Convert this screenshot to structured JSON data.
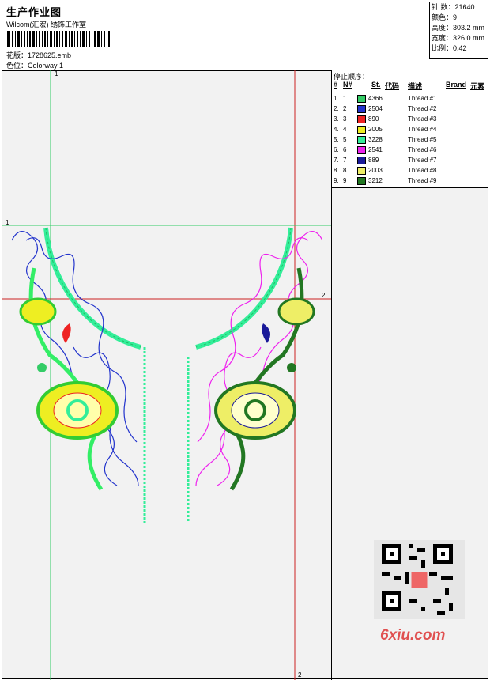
{
  "header": {
    "title": "生产作业图",
    "subtitle": "Wilcom(汇宏) 绣饰工作室",
    "pattern_label": "花版：",
    "pattern_value": "1728625.emb",
    "colorway_label": "色位：",
    "colorway_value": "Colorway 1"
  },
  "stats": [
    {
      "label": "针 数：",
      "value": "21640"
    },
    {
      "label": "颜色：",
      "value": "9"
    },
    {
      "label": "高度：",
      "value": "303.2 mm"
    },
    {
      "label": "宽度：",
      "value": "326.0 mm"
    },
    {
      "label": "比例：",
      "value": "0.42"
    }
  ],
  "thread_panel": {
    "title": "停止顺序：",
    "headers": {
      "num": "#",
      "n": "N#",
      "st": "St.",
      "code": "代码",
      "desc": "描述",
      "brand": "Brand",
      "element": "元素"
    },
    "rows": [
      {
        "idx": "1.",
        "n": "1",
        "code": "4366",
        "desc": "Thread #1",
        "color": "#33cc66"
      },
      {
        "idx": "2.",
        "n": "2",
        "code": "2504",
        "desc": "Thread #2",
        "color": "#2233cc"
      },
      {
        "idx": "3.",
        "n": "3",
        "code": "890",
        "desc": "Thread #3",
        "color": "#ee2222"
      },
      {
        "idx": "4.",
        "n": "4",
        "code": "2005",
        "desc": "Thread #4",
        "color": "#eeee22"
      },
      {
        "idx": "5.",
        "n": "5",
        "code": "3228",
        "desc": "Thread #5",
        "color": "#33ee99"
      },
      {
        "idx": "6.",
        "n": "6",
        "code": "2541",
        "desc": "Thread #6",
        "color": "#ee22ee"
      },
      {
        "idx": "7.",
        "n": "7",
        "code": "889",
        "desc": "Thread #7",
        "color": "#1a1a99"
      },
      {
        "idx": "8.",
        "n": "8",
        "code": "2003",
        "desc": "Thread #8",
        "color": "#eeee66"
      },
      {
        "idx": "9.",
        "n": "9",
        "code": "3212",
        "desc": "Thread #9",
        "color": "#227722"
      }
    ]
  },
  "guides": {
    "left_top": "1",
    "left_mid": "1",
    "right_mid": "2",
    "right_bottom": "2"
  },
  "watermark": "6xiu.com"
}
